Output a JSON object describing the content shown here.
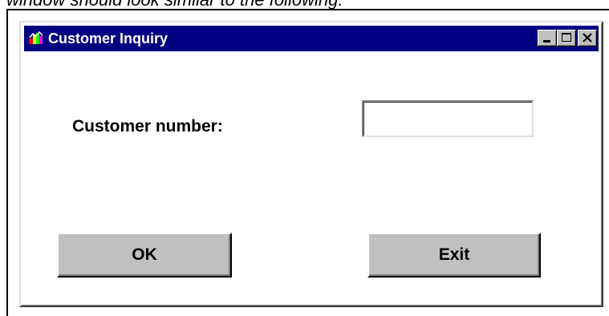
{
  "caption": "window should look similar to the following:",
  "window": {
    "title": "Customer Inquiry",
    "titlebar_color": "#000080",
    "controls": {
      "minimize_icon": "minimize-icon",
      "maximize_icon": "maximize-icon",
      "close_icon": "close-icon"
    }
  },
  "form": {
    "customer_number_label": "Customer number:",
    "customer_number_value": "",
    "customer_number_placeholder": ""
  },
  "buttons": {
    "ok_label": "OK",
    "exit_label": "Exit"
  },
  "colors": {
    "button_face": "#c0c0c0",
    "window_background": "#ffffff"
  }
}
